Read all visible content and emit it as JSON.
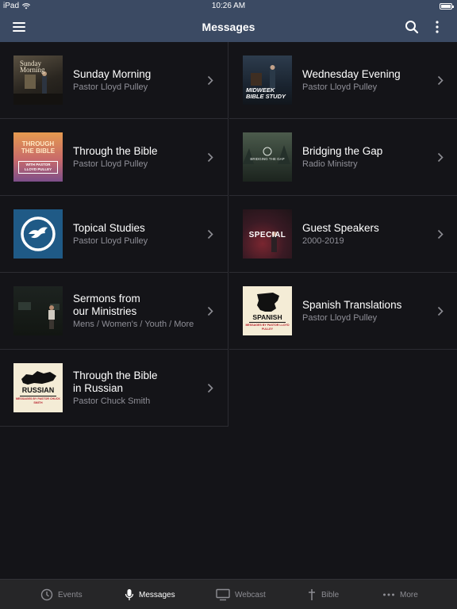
{
  "status_bar": {
    "device": "iPad",
    "time": "10:26 AM"
  },
  "nav": {
    "title": "Messages"
  },
  "items": [
    {
      "title": "Sunday Morning",
      "title2": "",
      "subtitle": "Pastor Lloyd Pulley",
      "thumb_text": "Sunday Morning",
      "thumb": "sunday-morning"
    },
    {
      "title": "Wednesday Evening",
      "title2": "",
      "subtitle": "Pastor Lloyd Pulley",
      "thumb_text": "MIDWEEK BIBLE STUDY",
      "thumb": "midweek"
    },
    {
      "title": "Through the Bible",
      "title2": "",
      "subtitle": "Pastor Lloyd Pulley",
      "thumb_text": "THROUGH THE BIBLE",
      "thumb_sub": "WITH PASTOR LLOYD PULLEY",
      "thumb": "through-bible"
    },
    {
      "title": "Bridging the Gap",
      "title2": "",
      "subtitle": "Radio Ministry",
      "thumb_text": "BRIDGING THE GAP",
      "thumb": "bridging"
    },
    {
      "title": "Topical Studies",
      "title2": "",
      "subtitle": "Pastor Lloyd Pulley",
      "thumb": "topical"
    },
    {
      "title": "Guest Speakers",
      "title2": "",
      "subtitle": "2000-2019",
      "thumb_text": "SPECIAL",
      "thumb": "guest"
    },
    {
      "title": "Sermons from",
      "title2": "our Ministries",
      "subtitle": "Mens / Women's / Youth / More",
      "thumb": "sermons"
    },
    {
      "title": "Spanish Translations",
      "title2": "",
      "subtitle": "Pastor Lloyd Pulley",
      "thumb_text": "SPANISH",
      "thumb_sub": "MESSAGES BY PASTOR LLOYD PULLEY",
      "thumb": "spanish"
    },
    {
      "title": "Through the Bible",
      "title2": "in Russian",
      "subtitle": "Pastor Chuck Smith",
      "thumb_text": "RUSSIAN",
      "thumb_sub": "MESSAGES BY PASTOR CHUCK SMITH",
      "thumb": "russian"
    }
  ],
  "tabs": [
    {
      "label": "Events",
      "icon": "clock-icon",
      "active": false
    },
    {
      "label": "Messages",
      "icon": "microphone-icon",
      "active": true
    },
    {
      "label": "Webcast",
      "icon": "monitor-icon",
      "active": false
    },
    {
      "label": "Bible",
      "icon": "cross-icon",
      "active": false
    },
    {
      "label": "More",
      "icon": "ellipsis-icon",
      "active": false
    }
  ],
  "colors": {
    "nav_bg": "#3b4a63",
    "page_bg": "#141418",
    "tab_bg": "#262628",
    "subtitle": "#8f8f97",
    "topical_blue": "#1f5a86"
  }
}
